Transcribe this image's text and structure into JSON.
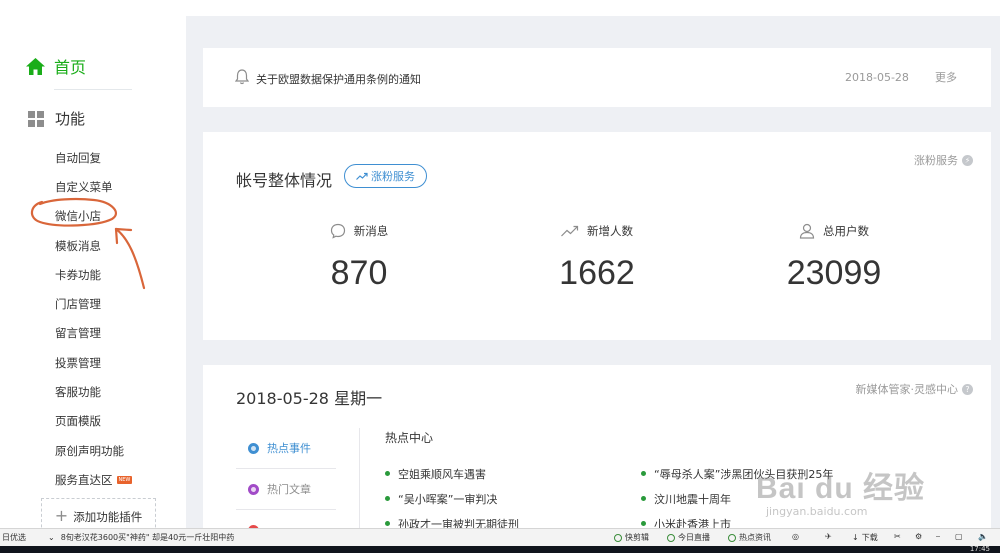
{
  "sidebar": {
    "home_label": "首页",
    "func_label": "功能",
    "items": [
      {
        "label": "自动回复"
      },
      {
        "label": "自定义菜单"
      },
      {
        "label": "微信小店"
      },
      {
        "label": "模板消息"
      },
      {
        "label": "卡券功能"
      },
      {
        "label": "门店管理"
      },
      {
        "label": "留言管理"
      },
      {
        "label": "投票管理"
      },
      {
        "label": "客服功能"
      },
      {
        "label": "页面模版"
      },
      {
        "label": "原创声明功能"
      },
      {
        "label": "服务直达区",
        "badge": "NEW"
      }
    ],
    "add_plugin_label": "添加功能插件"
  },
  "notice": {
    "text": "关于欧盟数据保护通用条例的通知",
    "date": "2018-05-28",
    "more": "更多"
  },
  "overview": {
    "title": "帐号整体情况",
    "service_button": "涨粉服务",
    "service_link": "涨粉服务",
    "stats": [
      {
        "label": "新消息",
        "value": "870",
        "icon": "message-icon"
      },
      {
        "label": "新增人数",
        "value": "1662",
        "icon": "trend-up-icon"
      },
      {
        "label": "总用户数",
        "value": "23099",
        "icon": "user-icon"
      }
    ]
  },
  "daily": {
    "date_title": "2018-05-28 星期一",
    "link": "新媒体管家·灵感中心",
    "tabs": [
      {
        "label": "热点事件"
      },
      {
        "label": "热门文章"
      },
      {
        "label": ""
      }
    ],
    "hot_title": "热点中心",
    "hot_left": [
      "空姐乘顺风车遇害",
      "“吴小晖案”一审判决",
      "孙政才一审被判无期徒刑"
    ],
    "hot_right": [
      "“辱母杀人案”涉黑团伙头目获刑25年",
      "汶川地震十周年",
      "小米赴香港上市"
    ]
  },
  "watermark": {
    "main": "Bai du 经验",
    "sub": "jingyan.baidu.com"
  },
  "taskbar": {
    "left_text": "日优选",
    "news_text": "8旬老汉花3600买\"神药\" 却是40元一斤壮阳中药",
    "items": [
      "快剪辑",
      "今日直播",
      "热点资讯",
      "下载"
    ],
    "clock": "17:45"
  },
  "colors": {
    "accent": "#1aad19",
    "link_blue": "#3f8fd2",
    "annotation": "#d9663a"
  }
}
